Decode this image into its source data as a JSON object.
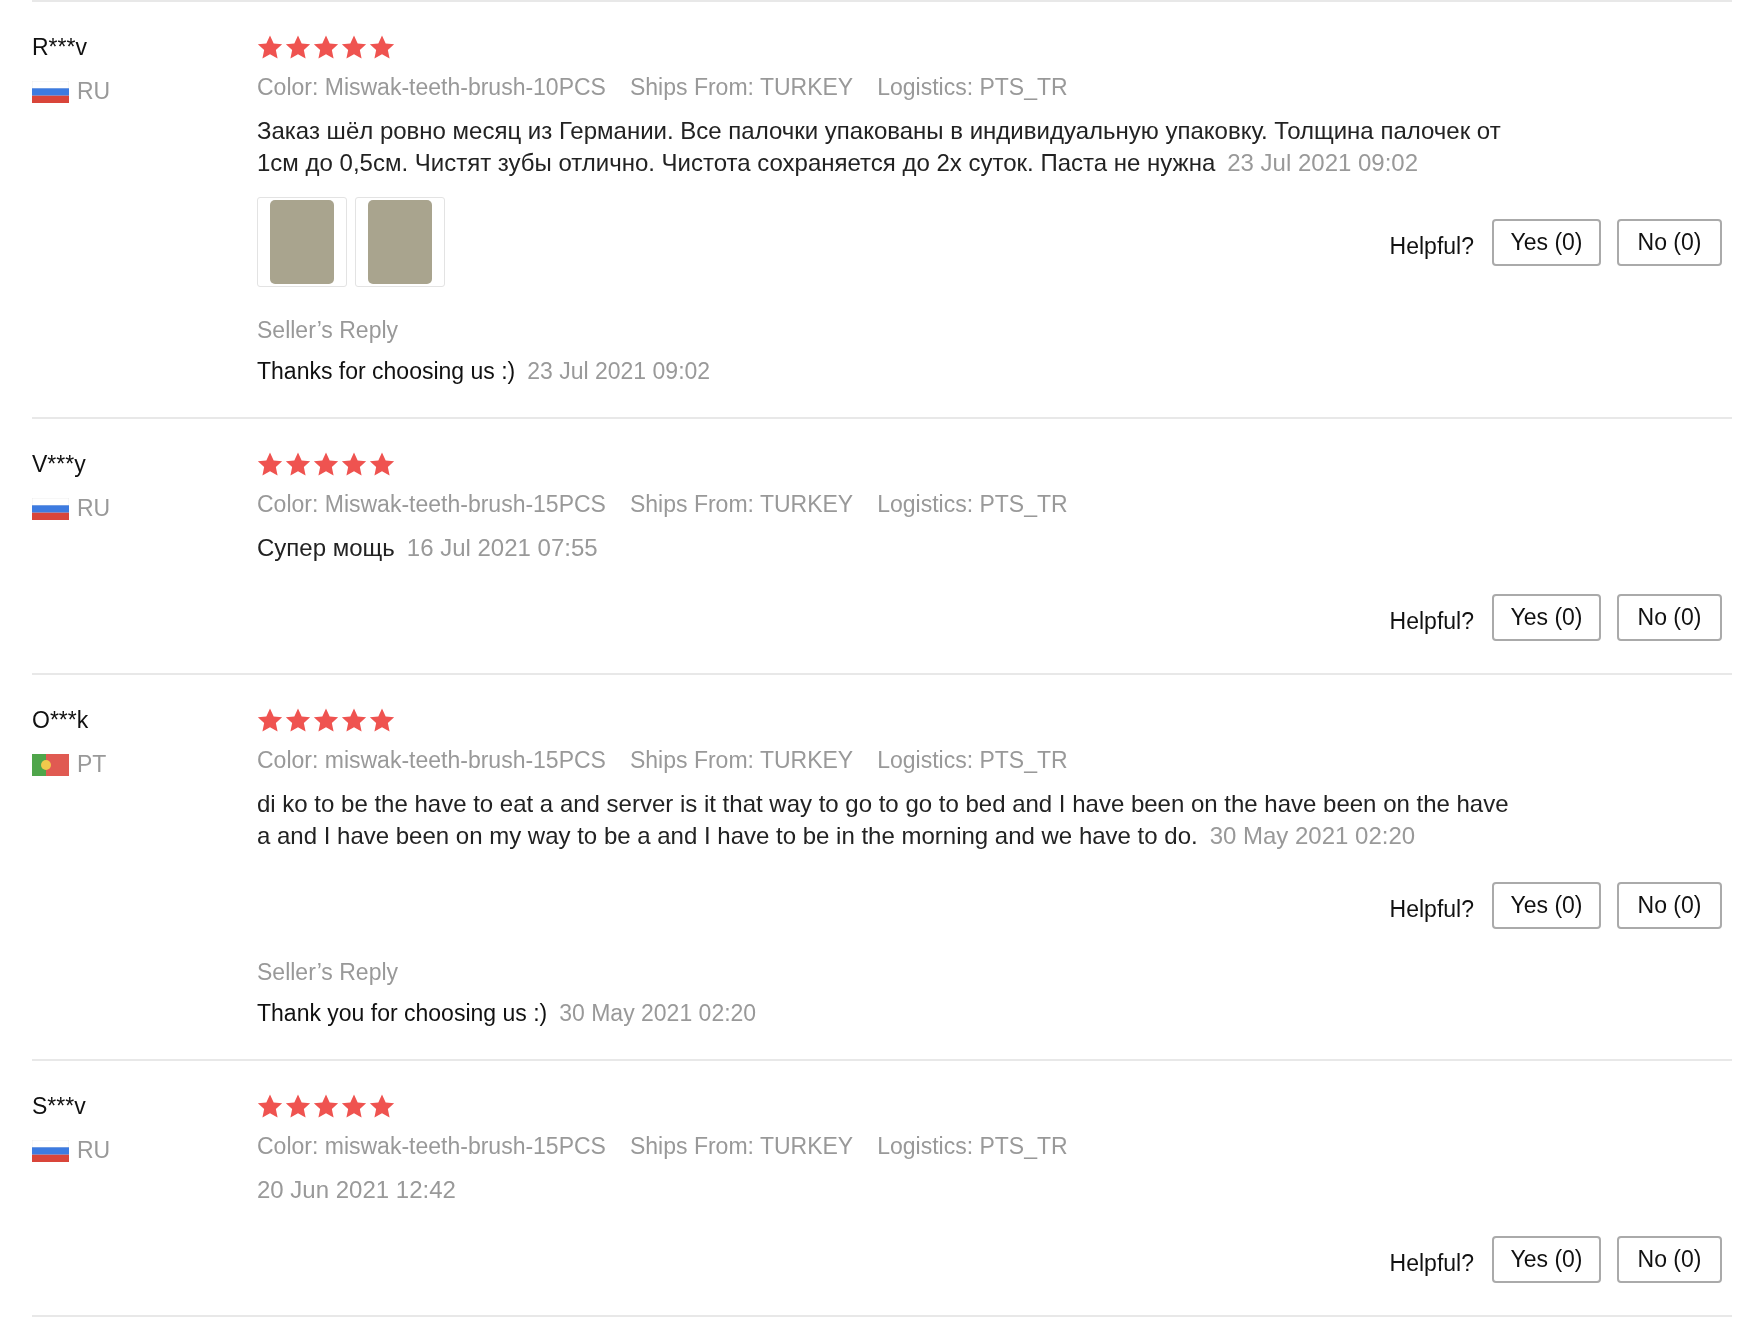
{
  "reviews": [
    {
      "name": "R***v",
      "flag": {
        "kind": "ru"
      },
      "country": "RU",
      "stars": 5,
      "meta": [
        {
          "label": "Color:",
          "value": "Miswak-teeth-brush-10PCS"
        },
        {
          "label": "Ships From:",
          "value": "TURKEY"
        },
        {
          "label": "Logistics:",
          "value": "PTS_TR"
        }
      ],
      "text": "Заказ шёл ровно месяц из Германии. Все палочки упакованы в индивидуальную упаковку. Толщина палочек от 1см до 0,5см. Чистят зубы отлично. Чистота сохраняется до 2х суток. Паста не нужна",
      "date": "23 Jul 2021 09:02",
      "photos": [
        {
          "kind": "photo"
        },
        {
          "kind": "photo"
        }
      ],
      "helpful": "Helpful?",
      "yes": "Yes (0)",
      "no": "No (0)",
      "reply": {
        "label": "Seller’s Reply",
        "text": "Thanks for choosing us :)",
        "date": "23 Jul 2021 09:02"
      }
    },
    {
      "name": "V***y",
      "flag": {
        "kind": "ru"
      },
      "country": "RU",
      "stars": 5,
      "meta": [
        {
          "label": "Color:",
          "value": "Miswak-teeth-brush-15PCS"
        },
        {
          "label": "Ships From:",
          "value": "TURKEY"
        },
        {
          "label": "Logistics:",
          "value": "PTS_TR"
        }
      ],
      "text": "Супер мощь",
      "date": "16 Jul 2021 07:55",
      "helpful": "Helpful?",
      "yes": "Yes (0)",
      "no": "No (0)"
    },
    {
      "name": "O***k",
      "flag": {
        "kind": "pt"
      },
      "country": "PT",
      "stars": 5,
      "meta": [
        {
          "label": "Color:",
          "value": "miswak-teeth-brush-15PCS"
        },
        {
          "label": "Ships From:",
          "value": "TURKEY"
        },
        {
          "label": "Logistics:",
          "value": "PTS_TR"
        }
      ],
      "text": "di ko to be the have to eat a and server is it that way to go to go to bed and I have been on the have been on the have a and I have been on my way to be a and I have to be in the morning and we have to do.",
      "date": "30 May 2021 02:20",
      "helpful": "Helpful?",
      "yes": "Yes (0)",
      "no": "No (0)",
      "reply": {
        "label": "Seller’s Reply",
        "text": "Thank you for choosing us :)",
        "date": "30 May 2021 02:20"
      }
    },
    {
      "name": "S***v",
      "flag": {
        "kind": "ru"
      },
      "country": "RU",
      "stars": 5,
      "meta": [
        {
          "label": "Color:",
          "value": "miswak-teeth-brush-15PCS"
        },
        {
          "label": "Ships From:",
          "value": "TURKEY"
        },
        {
          "label": "Logistics:",
          "value": "PTS_TR"
        }
      ],
      "date": "20 Jun 2021 12:42",
      "helpful": "Helpful?",
      "yes": "Yes (0)",
      "no": "No (0)"
    }
  ]
}
